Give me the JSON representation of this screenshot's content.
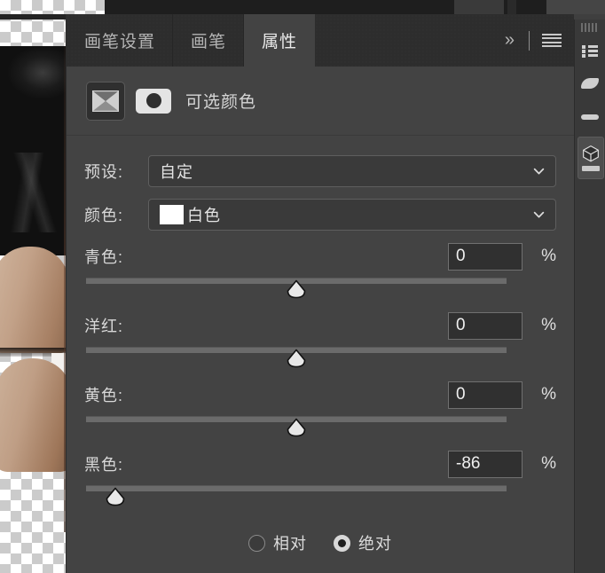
{
  "panel": {
    "tabs": [
      {
        "label": "画笔设置",
        "active": false
      },
      {
        "label": "画笔",
        "active": false
      },
      {
        "label": "属性",
        "active": true
      }
    ],
    "collapse_glyph": "»",
    "menu_icon": "hamburger-icon",
    "adjustment": {
      "icon": "selective-color-adjustment-icon",
      "mask_icon": "layer-mask-thumbnail-icon",
      "title": "可选颜色"
    },
    "fields": {
      "preset": {
        "label": "预设:",
        "value": "自定"
      },
      "colors": {
        "label": "颜色:",
        "value": "白色",
        "swatch": "#ffffff"
      }
    },
    "sliders": [
      {
        "label": "青色:",
        "value": "0",
        "unit": "%",
        "position_pct": 50
      },
      {
        "label": "洋红:",
        "value": "0",
        "unit": "%",
        "position_pct": 50
      },
      {
        "label": "黄色:",
        "value": "0",
        "unit": "%",
        "position_pct": 50
      },
      {
        "label": "黑色:",
        "value": "-86",
        "unit": "%",
        "position_pct": 7
      }
    ],
    "method": [
      {
        "label": "相对",
        "selected": false
      },
      {
        "label": "绝对",
        "selected": true
      }
    ]
  },
  "right_rail": {
    "items": [
      {
        "icon": "panel-grip-icon",
        "active": false
      },
      {
        "icon": "properties-list-icon",
        "active": false
      },
      {
        "icon": "brush-leaf-icon",
        "active": false
      },
      {
        "icon": "gradient-bar-icon",
        "active": false
      },
      {
        "icon": "3d-cube-icon",
        "active": true
      }
    ]
  },
  "colors": {
    "panel_bg": "#434343",
    "tabbar_bg": "#2d2d2d",
    "text": "#d8d8d8",
    "input_bg": "#303030",
    "track": "#6b6b6b",
    "thumb": "#e8e8e8"
  }
}
